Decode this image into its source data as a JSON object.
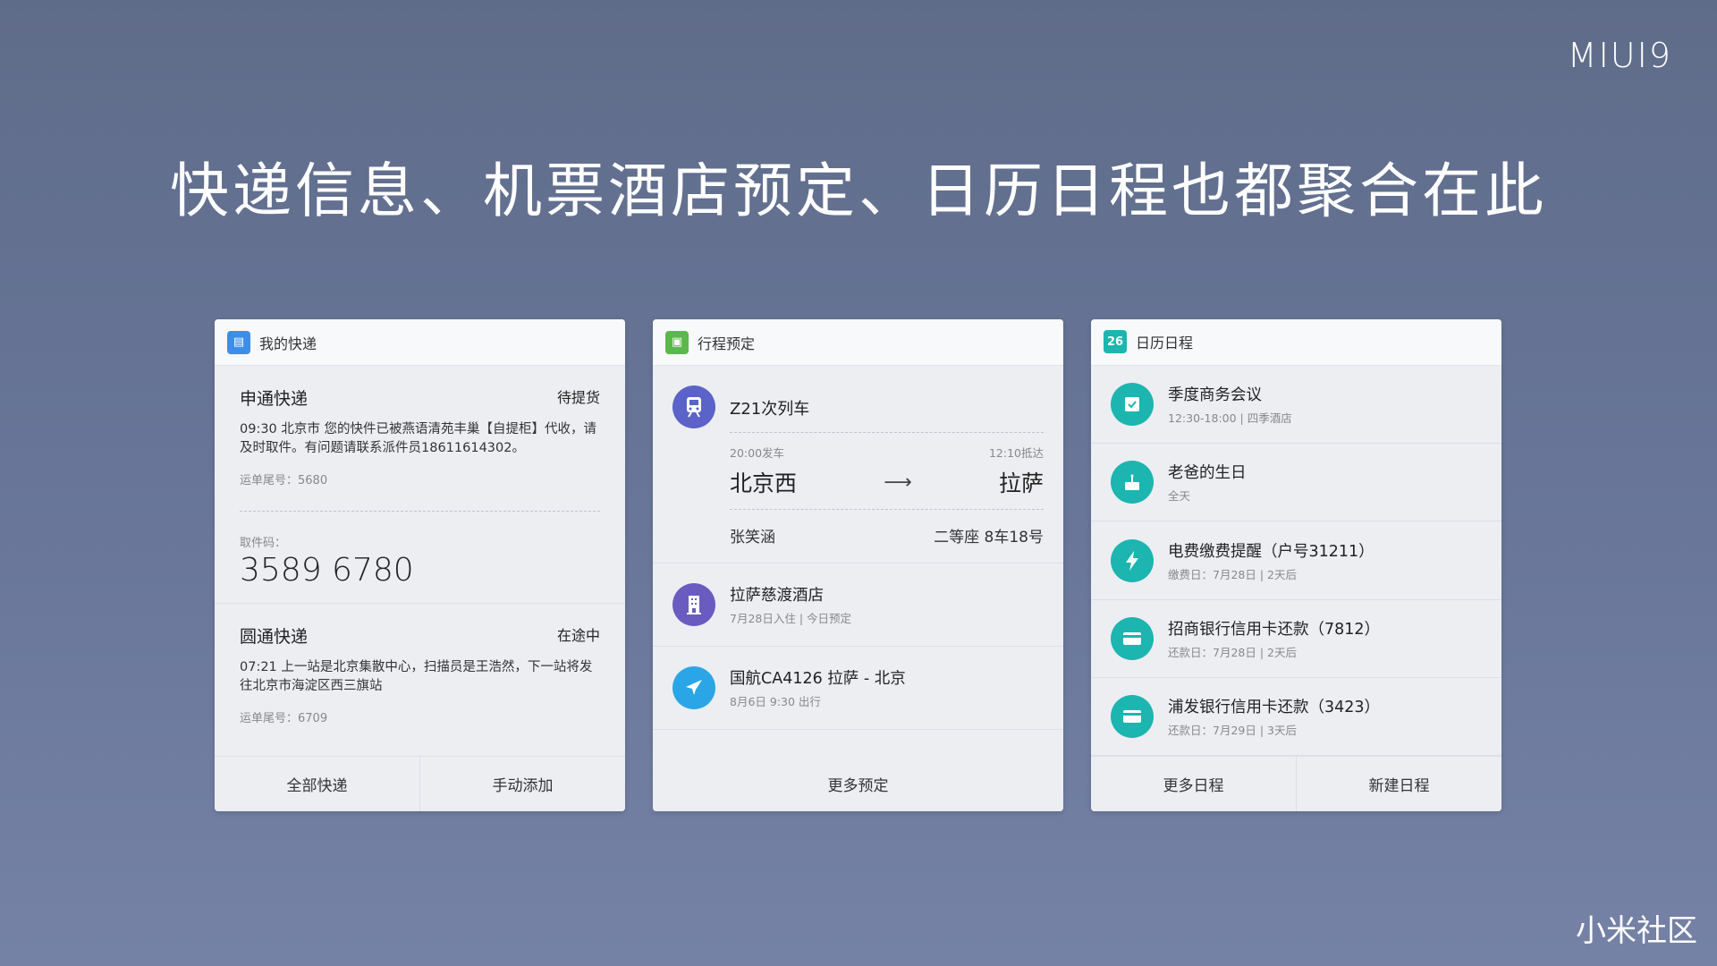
{
  "brand": "MIUI9",
  "headline": "快递信息、机票酒店预定、日历日程也都聚合在此",
  "watermark": "小米社区",
  "express": {
    "title": "我的快递",
    "icon": "package-icon",
    "packages": [
      {
        "company": "申通快递",
        "status": "待提货",
        "message": "09:30 北京市 您的快件已被燕语清苑丰巢【自提柜】代收，请及时取件。有问题请联系派件员18611614302。",
        "tail": "运单尾号：5680",
        "code_label": "取件码：",
        "code": "3589 6780"
      },
      {
        "company": "圆通快递",
        "status": "在途中",
        "message": "07:21 上一站是北京集散中心，扫描员是王浩然，下一站将发往北京市海淀区西三旗站",
        "tail": "运单尾号：6709"
      }
    ],
    "buttons": [
      "全部快递",
      "手动添加"
    ],
    "color": "#3d8ee8"
  },
  "trip": {
    "title": "行程预定",
    "icon": "ticket-icon",
    "color": "#5cb84a",
    "train": {
      "name": "Z21次列车",
      "depart_time": "20:00发车",
      "arrive_time": "12:10抵达",
      "from": "北京西",
      "arrow": "⟶",
      "to": "拉萨",
      "passenger": "张笑涵",
      "seat": "二等座  8车18号",
      "color": "#5b63c8"
    },
    "items": [
      {
        "title": "拉萨慈渡酒店",
        "sub": "7月28日入住 | 今日预定",
        "icon": "hotel-icon",
        "color": "#6a5bc0"
      },
      {
        "title": "国航CA4126 拉萨 - 北京",
        "sub": "8月6日 9:30 出行",
        "icon": "plane-icon",
        "color": "#2aa6e6"
      }
    ],
    "button": "更多预定"
  },
  "calendar": {
    "title": "日历日程",
    "badge": "26",
    "color": "#1cb5b0",
    "items": [
      {
        "title": "季度商务会议",
        "sub": "12:30-18:00 | 四季酒店",
        "icon": "check-icon",
        "glyph": "☑"
      },
      {
        "title": "老爸的生日",
        "sub": "全天",
        "icon": "cake-icon",
        "glyph": "🎂"
      },
      {
        "title": "电费缴费提醒（户号31211）",
        "sub": "缴费日：7月28日 | 2天后",
        "icon": "lightning-icon",
        "glyph": "⚡"
      },
      {
        "title": "招商银行信用卡还款（7812）",
        "sub": "还款日：7月28日 | 2天后",
        "icon": "card-icon",
        "glyph": "▭"
      },
      {
        "title": "浦发银行信用卡还款（3423）",
        "sub": "还款日：7月29日 | 3天后",
        "icon": "card-icon",
        "glyph": "▭"
      }
    ],
    "buttons": [
      "更多日程",
      "新建日程"
    ]
  }
}
